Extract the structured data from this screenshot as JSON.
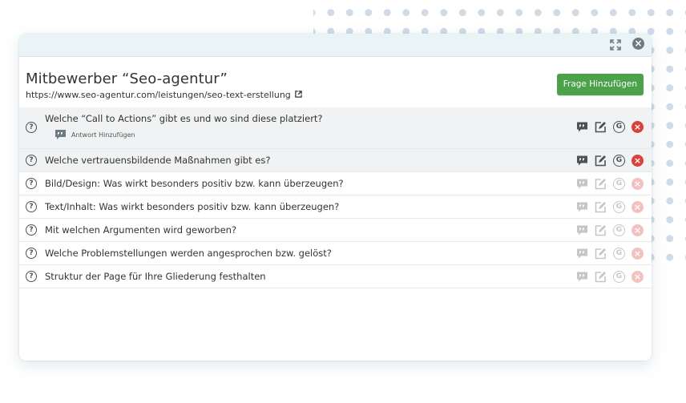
{
  "panel": {
    "title": "Mitbewerber “Seo-agentur”",
    "url": "https://www.seo-agentur.com/leistungen/seo-text-erstellung",
    "add_button_label": "Frage Hinzufügen"
  },
  "questions": [
    {
      "text": "Welche “Call to Actions” gibt es und wo sind diese platziert?",
      "answer_label": "Antwort Hinzufügen"
    },
    {
      "text": "Welche vertrauensbildende Maßnahmen gibt es?"
    },
    {
      "text": "Bild/Design: Was wirkt besonders positiv bzw. kann überzeugen?"
    },
    {
      "text": "Text/Inhalt: Was wirkt besonders positiv bzw. kann überzeugen?"
    },
    {
      "text": "Mit welchen Argumenten wird geworben?"
    },
    {
      "text": "Welche Problemstellungen werden angesprochen bzw. gelöst?"
    },
    {
      "text": "Struktur der Page für Ihre Gliederung festhalten"
    }
  ],
  "icons": {
    "question": "question-circle-icon",
    "answer": "speech-bubble-icon",
    "edit": "edit-icon",
    "grammar": "g-circle-icon",
    "delete": "delete-circle-icon"
  },
  "colors": {
    "accent_green": "#4ba24a",
    "delete_red": "#d9413d",
    "topbar": "#eaf4f6",
    "dots": "#cfdbe6"
  }
}
